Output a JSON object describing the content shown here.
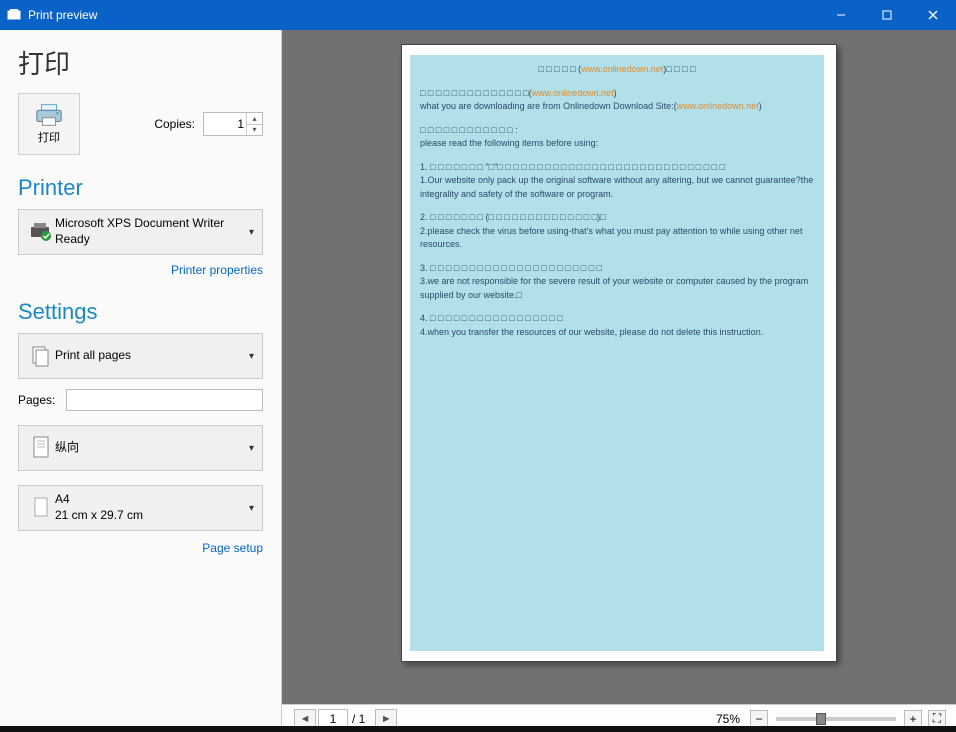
{
  "window": {
    "title": "Print preview"
  },
  "left": {
    "print_heading": "打印",
    "print_button_label": "打印",
    "copies_label": "Copies:",
    "copies_value": "1",
    "printer_heading": "Printer",
    "printer_name": "Microsoft XPS Document Writer",
    "printer_status": "Ready",
    "printer_properties_link": "Printer properties",
    "settings_heading": "Settings",
    "print_range_label": "Print all pages",
    "pages_label": "Pages:",
    "pages_value": "",
    "orientation_label": "纵向",
    "paper_name": "A4",
    "paper_size": "21 cm x 29.7 cm",
    "page_setup_link": "Page setup"
  },
  "document": {
    "header": {
      "pre": "□ □ □ □ □ (",
      "url": "www.onlinedown.net",
      "post": ")□ □ □ □"
    },
    "line2_pre": "□ □ □ □ □ □ □ □ □ □ □ □ □ □(",
    "line2_url": "www.onlinedown.net",
    "line2_post": ")",
    "line3_pre": "what you are downloading are from Onlinedown Download Site:(",
    "line3_url": "www.onlinedown.net",
    "line3_post": ")",
    "line4": "□ □ □ □ □ □ □ □ □ □ □ □ :",
    "line5": "please read the following items before using:",
    "item1a": "1. □ □ □ □ □ □ □ \"□\"□ □ □ □ □ □ □ □ □ □ □ □ □ □ □ □ □ □ □ □ □ □ □ □ □ □ □ □ □",
    "item1b": "1.Our website only pack up the original software without any altering, but we cannot guarantee?the integrality and safety of the software or program.",
    "item2a": "2. □ □ □ □ □ □ □ (□ □ □ □ □ □ □ □ □ □ □ □ □ □)□",
    "item2b": "2.please check the virus before using-that's what you must pay attention to while using other net resources.",
    "item3a": "3. □ □ □ □ □ □ □ □ □ □ □ □ □ □ □ □ □ □ □ □ □ □",
    "item3b": "3.we are not responsible for the severe result of your website or computer caused by the program supplied by our website.□",
    "item4a": "4. □ □ □ □ □ □ □ □ □ □ □ □ □ □ □ □ □",
    "item4b": "4.when you transfer the resources of our website, please do not delete this instruction."
  },
  "bottombar": {
    "current_page": "1",
    "total_pages": "/ 1",
    "zoom": "75%"
  }
}
